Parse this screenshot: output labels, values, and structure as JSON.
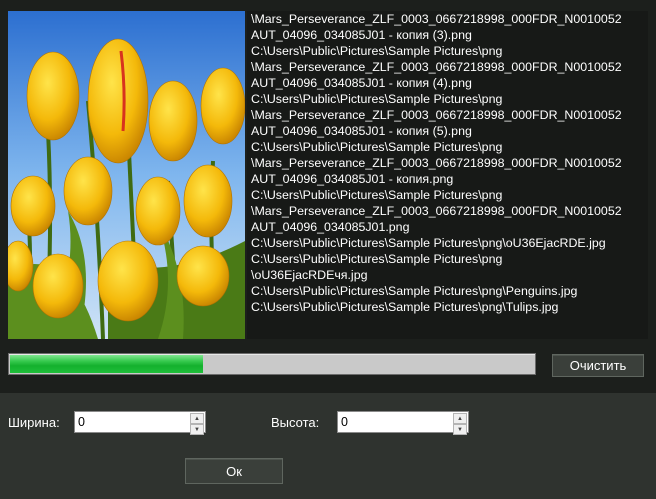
{
  "file_list": {
    "lines": [
      "\\Mars_Perseverance_ZLF_0003_0667218998_000FDR_N0010052",
      "AUT_04096_034085J01 - копия (3).png",
      "C:\\Users\\Public\\Pictures\\Sample Pictures\\png",
      "\\Mars_Perseverance_ZLF_0003_0667218998_000FDR_N0010052",
      "AUT_04096_034085J01 - копия (4).png",
      "C:\\Users\\Public\\Pictures\\Sample Pictures\\png",
      "\\Mars_Perseverance_ZLF_0003_0667218998_000FDR_N0010052",
      "AUT_04096_034085J01 - копия (5).png",
      "C:\\Users\\Public\\Pictures\\Sample Pictures\\png",
      "\\Mars_Perseverance_ZLF_0003_0667218998_000FDR_N0010052",
      "AUT_04096_034085J01 - копия.png",
      "C:\\Users\\Public\\Pictures\\Sample Pictures\\png",
      "\\Mars_Perseverance_ZLF_0003_0667218998_000FDR_N0010052",
      "AUT_04096_034085J01.png",
      "C:\\Users\\Public\\Pictures\\Sample Pictures\\png\\oU36EjacRDE.jpg",
      "C:\\Users\\Public\\Pictures\\Sample Pictures\\png",
      "\\oU36EjacRDEчя.jpg",
      "C:\\Users\\Public\\Pictures\\Sample Pictures\\png\\Penguins.jpg",
      "C:\\Users\\Public\\Pictures\\Sample Pictures\\png\\Tulips.jpg"
    ]
  },
  "preview": {
    "icon": "tulips-image"
  },
  "progress": {
    "fraction": 0.37,
    "color": "#1fc03a"
  },
  "buttons": {
    "clear_label": "Очистить",
    "ok_label": "Ок"
  },
  "size": {
    "width_label": "Ширина:",
    "width_value": "0",
    "height_label": "Высота:",
    "height_value": "0"
  },
  "colors": {
    "background": "#2b2e2b",
    "list_background": "#171917",
    "text": "#ffffff"
  }
}
